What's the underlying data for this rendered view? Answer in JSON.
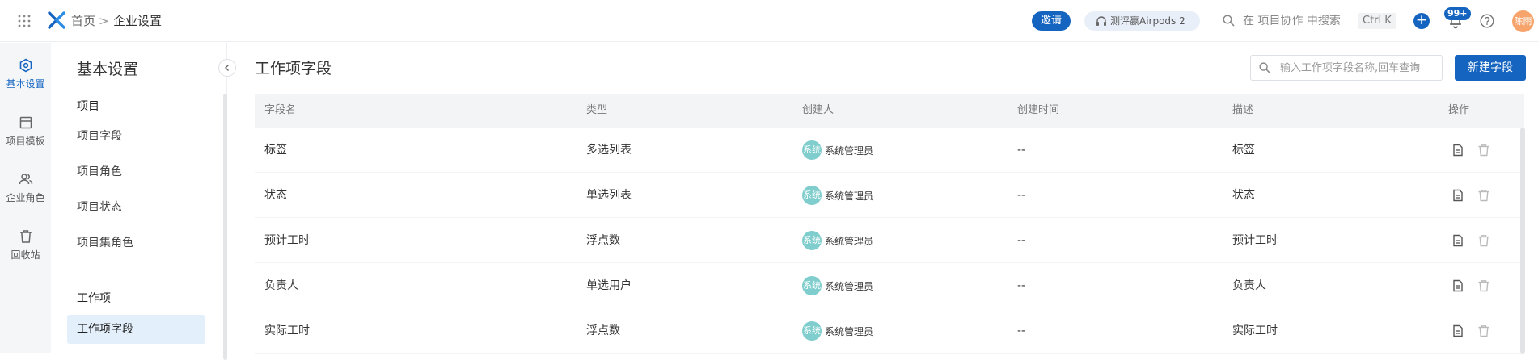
{
  "topbar": {
    "breadcrumb": {
      "home": "首页",
      "separator": ">",
      "current": "企业设置"
    },
    "invite_label": "邀请",
    "promo_label": "测评赢Airpods 2",
    "search": {
      "placeholder": "在 项目协作 中搜索",
      "shortcut": "Ctrl K"
    },
    "plus_label": "+",
    "notification_count": "99+",
    "user_avatar_text": "陈雨"
  },
  "rail": {
    "items": [
      {
        "label": "基本设置",
        "icon": "hexagon-settings-icon",
        "active": true
      },
      {
        "label": "项目模板",
        "icon": "template-icon",
        "active": false
      },
      {
        "label": "企业角色",
        "icon": "people-icon",
        "active": false
      },
      {
        "label": "回收站",
        "icon": "trash-icon",
        "active": false
      }
    ]
  },
  "nav": {
    "title": "基本设置",
    "groups": [
      {
        "title": "项目",
        "items": [
          "项目字段",
          "项目角色",
          "项目状态",
          "项目集角色"
        ]
      },
      {
        "title": "工作项",
        "items": [
          "工作项字段"
        ]
      }
    ],
    "active_item": "工作项字段"
  },
  "main": {
    "title": "工作项字段",
    "search_placeholder": "输入工作项字段名称,回车查询",
    "new_button_label": "新建字段",
    "table": {
      "headers": [
        "字段名",
        "类型",
        "创建人",
        "创建时间",
        "描述",
        "操作"
      ],
      "rows": [
        {
          "name": "标签",
          "type": "多选列表",
          "creator_avatar": "系统",
          "creator": "系统管理员",
          "created_at": "--",
          "description": "标签"
        },
        {
          "name": "状态",
          "type": "单选列表",
          "creator_avatar": "系统",
          "creator": "系统管理员",
          "created_at": "--",
          "description": "状态"
        },
        {
          "name": "预计工时",
          "type": "浮点数",
          "creator_avatar": "系统",
          "creator": "系统管理员",
          "created_at": "--",
          "description": "预计工时"
        },
        {
          "name": "负责人",
          "type": "单选用户",
          "creator_avatar": "系统",
          "creator": "系统管理员",
          "created_at": "--",
          "description": "负责人"
        },
        {
          "name": "实际工时",
          "type": "浮点数",
          "creator_avatar": "系统",
          "creator": "系统管理员",
          "created_at": "--",
          "description": "实际工时"
        }
      ]
    }
  },
  "colors": {
    "primary": "#1565c0",
    "avatar_teal": "#7fcdcc",
    "avatar_orange": "#f6a46b",
    "active_nav_bg": "#e3effa"
  }
}
